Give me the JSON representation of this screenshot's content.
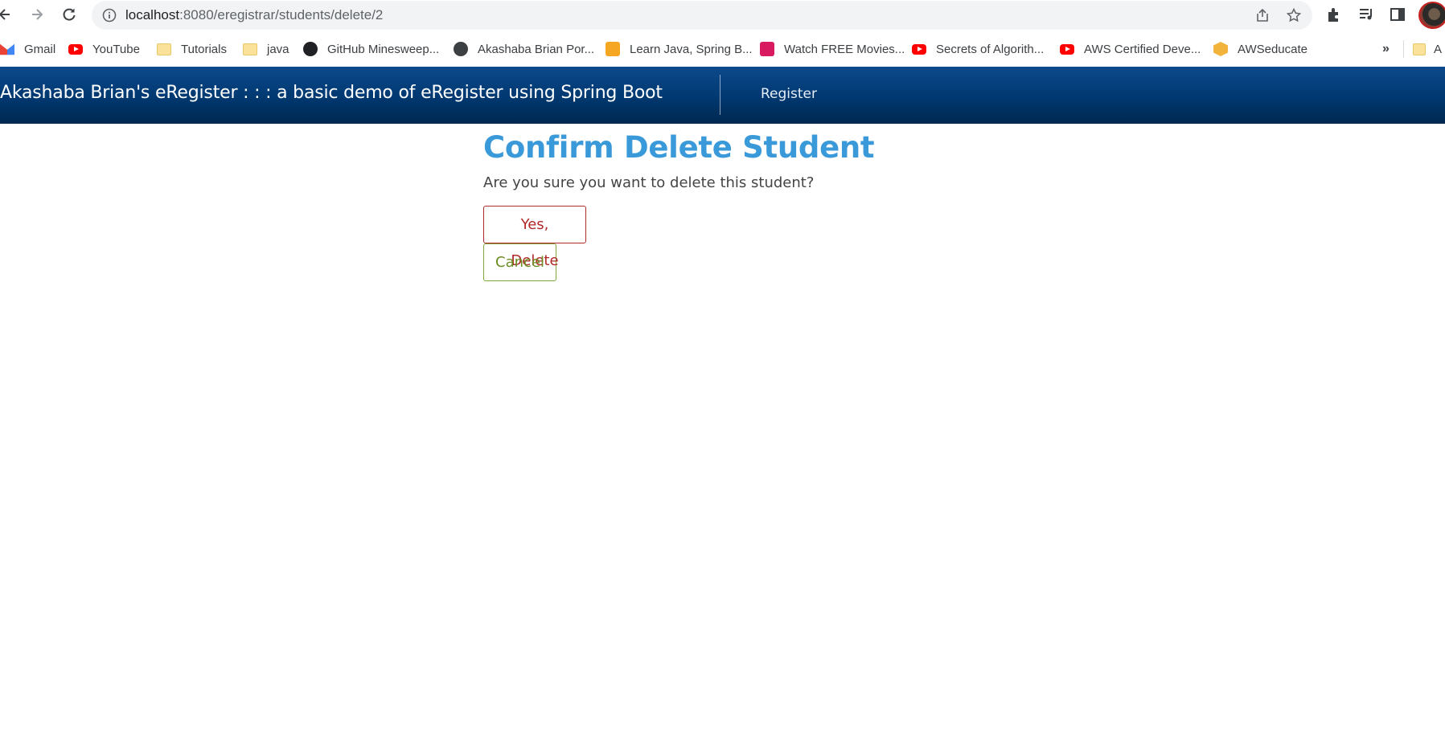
{
  "browser": {
    "url_host": "localhost",
    "url_rest": ":8080/eregistrar/students/delete/2"
  },
  "bookmarks": [
    {
      "label": "Gmail",
      "icon": "gmail-icon"
    },
    {
      "label": "YouTube",
      "icon": "youtube-icon"
    },
    {
      "label": "Tutorials",
      "icon": "folder-icon"
    },
    {
      "label": "java",
      "icon": "folder-icon"
    },
    {
      "label": "GitHub Minesweep...",
      "icon": "github-icon"
    },
    {
      "label": "Akashaba Brian Por...",
      "icon": "globe-icon"
    },
    {
      "label": "Learn Java, Spring B...",
      "icon": "code-icon"
    },
    {
      "label": "Watch FREE Movies...",
      "icon": "movie-icon"
    },
    {
      "label": "Secrets of Algorith...",
      "icon": "youtube-icon"
    },
    {
      "label": "AWS Certified Deve...",
      "icon": "youtube-icon"
    },
    {
      "label": "AWSeducate",
      "icon": "aws-icon"
    }
  ],
  "bookmarks_more": "»",
  "bookmarks_last": "A",
  "navbar": {
    "brand": "Akashaba Brian's eRegister : : : a basic demo of eRegister using Spring Boot",
    "link_register": "Register"
  },
  "main": {
    "title": "Confirm Delete Student",
    "message": "Are you sure you want to delete this student?",
    "delete_label": "Yes, Delete",
    "cancel_label": "Cancel"
  },
  "colors": {
    "title": "#3a9ad9",
    "navbar": "#003870",
    "delete": "#b02a2a",
    "cancel": "#6b8e23"
  }
}
